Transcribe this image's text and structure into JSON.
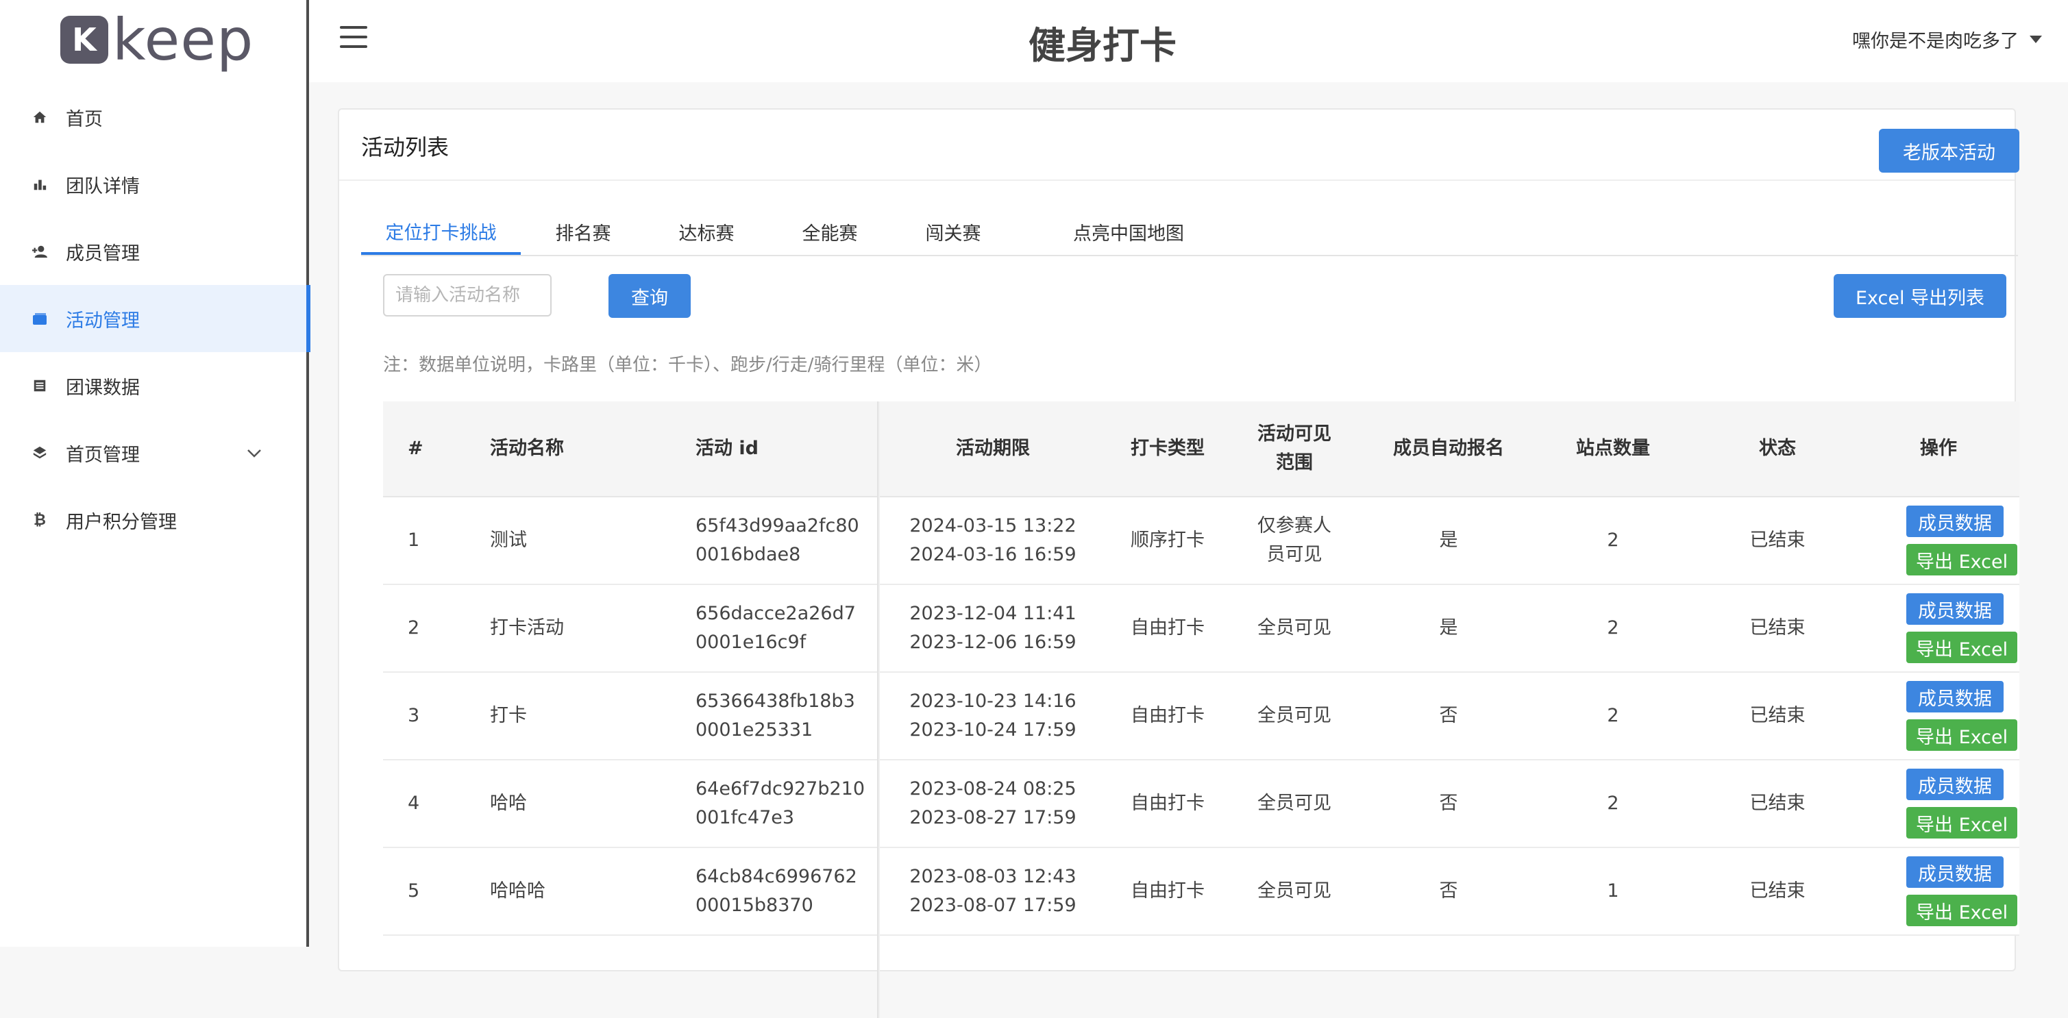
{
  "logo": {
    "mark": "K",
    "word": "keep"
  },
  "sidebar": {
    "items": [
      {
        "label": "首页",
        "icon": "home-icon"
      },
      {
        "label": "团队详情",
        "icon": "bar-chart-icon"
      },
      {
        "label": "成员管理",
        "icon": "add-user-icon"
      },
      {
        "label": "活动管理",
        "icon": "folder-icon",
        "active": true
      },
      {
        "label": "团课数据",
        "icon": "list-icon"
      },
      {
        "label": "首页管理",
        "icon": "layers-icon",
        "expandable": true
      },
      {
        "label": "用户积分管理",
        "icon": "bitcoin-icon"
      }
    ]
  },
  "header": {
    "title": "健身打卡",
    "user": "嘿你是不是肉吃多了"
  },
  "card": {
    "title": "活动列表",
    "old_button": "老版本活动",
    "tabs": [
      "定位打卡挑战",
      "排名赛",
      "达标赛",
      "全能赛",
      "闯关赛",
      "点亮中国地图"
    ],
    "search": {
      "placeholder": "请输入活动名称",
      "value": ""
    },
    "query_button": "查询",
    "excel_button": "Excel 导出列表",
    "note": "注：数据单位说明，卡路里（单位：千卡）、跑步/行走/骑行里程（单位：米）"
  },
  "table": {
    "columns": [
      "#",
      "活动名称",
      "活动 id",
      "活动期限",
      "打卡类型",
      "活动可见\n范围",
      "成员自动报名",
      "站点数量",
      "状态",
      "操作"
    ],
    "rows": [
      {
        "no": "1",
        "name": "测试",
        "id1": "65f43d99aa2fc80",
        "id2": "0016bdae8",
        "start": "2024-03-15 13:22",
        "end": "2024-03-16 16:59",
        "type": "顺序打卡",
        "scope": "仅参赛人\n员可见",
        "auto": "是",
        "sites": "2",
        "status": "已结束"
      },
      {
        "no": "2",
        "name": "打卡活动",
        "id1": "656dacce2a26d7",
        "id2": "0001e16c9f",
        "start": "2023-12-04 11:41",
        "end": "2023-12-06 16:59",
        "type": "自由打卡",
        "scope": "全员可见",
        "auto": "是",
        "sites": "2",
        "status": "已结束"
      },
      {
        "no": "3",
        "name": "打卡",
        "id1": "65366438fb18b3",
        "id2": "0001e25331",
        "start": "2023-10-23 14:16",
        "end": "2023-10-24 17:59",
        "type": "自由打卡",
        "scope": "全员可见",
        "auto": "否",
        "sites": "2",
        "status": "已结束"
      },
      {
        "no": "4",
        "name": "哈哈",
        "id1": "64e6f7dc927b210",
        "id2": "001fc47e3",
        "start": "2023-08-24 08:25",
        "end": "2023-08-27 17:59",
        "type": "自由打卡",
        "scope": "全员可见",
        "auto": "否",
        "sites": "2",
        "status": "已结束"
      },
      {
        "no": "5",
        "name": "哈哈哈",
        "id1": "64cb84c6996762",
        "id2": "00015b8370",
        "start": "2023-08-03 12:43",
        "end": "2023-08-07 17:59",
        "type": "自由打卡",
        "scope": "全员可见",
        "auto": "否",
        "sites": "1",
        "status": "已结束"
      }
    ],
    "op_member": "成员数据",
    "op_export": "导出 Excel"
  },
  "colors": {
    "accent": "#2c7be5",
    "button_blue": "#3d86e0",
    "button_green": "#4cb14c",
    "active_bg": "#eaf2fd"
  }
}
